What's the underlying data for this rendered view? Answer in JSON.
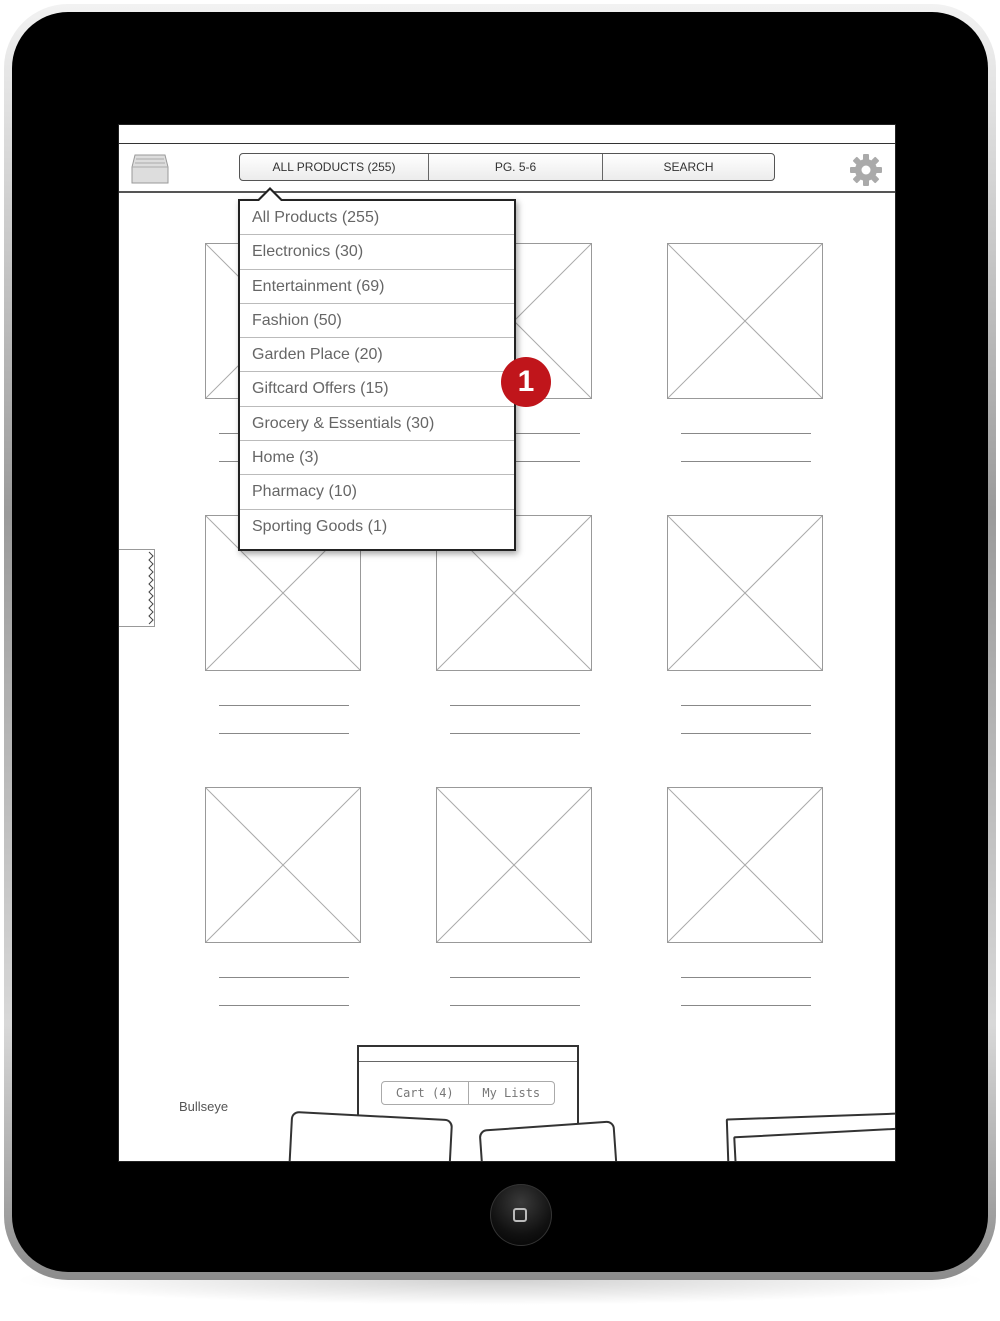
{
  "toolbar": {
    "tabs": [
      {
        "label": "ALL PRODUCTS (255)"
      },
      {
        "label": "PG. 5-6"
      },
      {
        "label": "SEARCH"
      }
    ]
  },
  "dropdown": {
    "items": [
      {
        "label": "All Products (255)"
      },
      {
        "label": "Electronics (30)"
      },
      {
        "label": "Entertainment (69)"
      },
      {
        "label": "Fashion (50)"
      },
      {
        "label": "Garden Place (20)"
      },
      {
        "label": "Giftcard Offers (15)"
      },
      {
        "label": "Grocery & Essentials (30)"
      },
      {
        "label": "Home (3)"
      },
      {
        "label": "Pharmacy (10)"
      },
      {
        "label": "Sporting Goods (1)"
      }
    ]
  },
  "annotation": {
    "number": "1",
    "color": "#c0151b"
  },
  "bottom": {
    "brand": "Bullseye",
    "tray_tabs": [
      {
        "label": "Cart (4)"
      },
      {
        "label": "My Lists"
      }
    ]
  },
  "icons": {
    "left": "tray-icon",
    "right": "gear-icon"
  }
}
